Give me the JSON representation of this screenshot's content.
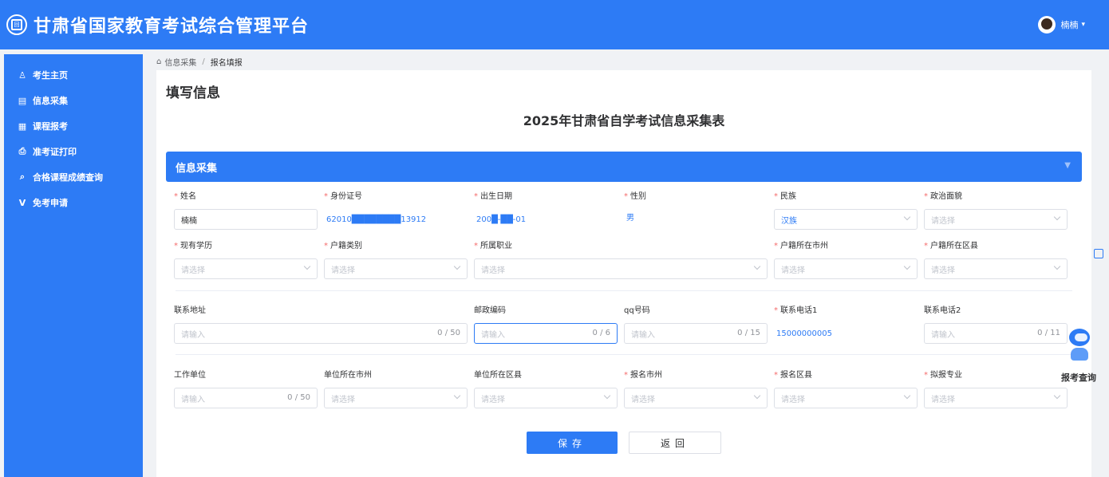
{
  "header": {
    "logo_glyph": "回",
    "title": "甘肃省国家教育考试综合管理平台",
    "username": "楠楠",
    "caret": "▾"
  },
  "sidebar": {
    "items": [
      {
        "icon": "user-icon",
        "glyph": "♙",
        "label": "考生主页"
      },
      {
        "icon": "document-icon",
        "glyph": "▤",
        "label": "信息采集"
      },
      {
        "icon": "calendar-icon",
        "glyph": "▦",
        "label": "课程报考"
      },
      {
        "icon": "print-icon",
        "glyph": "⎙",
        "label": "准考证打印"
      },
      {
        "icon": "search-icon",
        "glyph": "⌕",
        "label": "合格课程成绩查询"
      },
      {
        "icon": "exempt-icon",
        "glyph": "V",
        "label": "免考申请"
      }
    ]
  },
  "breadcrumb": {
    "home_glyph": "⌂",
    "parent": "信息采集",
    "sep": "/",
    "current": "报名填报"
  },
  "page": {
    "title": "填写信息",
    "form_title": "2025年甘肃省自学考试信息采集表",
    "section": "信息采集"
  },
  "fields": {
    "name": {
      "label": "姓名",
      "value": "楠楠"
    },
    "idcard": {
      "label": "身份证号",
      "value": "62010████████13912"
    },
    "birth": {
      "label": "出生日期",
      "value": "200█-██-01"
    },
    "gender": {
      "label": "性别",
      "value": "男"
    },
    "ethnic": {
      "label": "民族",
      "value": "汉族"
    },
    "political": {
      "label": "政治面貌",
      "placeholder": "请选择"
    },
    "education": {
      "label": "现有学历",
      "placeholder": "请选择"
    },
    "hukou_type": {
      "label": "户籍类别",
      "placeholder": "请选择"
    },
    "occupation": {
      "label": "所属职业",
      "placeholder": "请选择"
    },
    "hukou_city": {
      "label": "户籍所在市州",
      "placeholder": "请选择"
    },
    "hukou_county": {
      "label": "户籍所在区县",
      "placeholder": "请选择"
    },
    "address": {
      "label": "联系地址",
      "placeholder": "请输入",
      "count": "0 / 50"
    },
    "postcode": {
      "label": "邮政编码",
      "placeholder": "请输入",
      "count": "0 / 6"
    },
    "qq": {
      "label": "qq号码",
      "placeholder": "请输入",
      "count": "0 / 15"
    },
    "phone1": {
      "label": "联系电话1",
      "value": "15000000005"
    },
    "phone2": {
      "label": "联系电话2",
      "placeholder": "请输入",
      "count": "0 / 11"
    },
    "employer": {
      "label": "工作单位",
      "placeholder": "请输入",
      "count": "0 / 50"
    },
    "employer_city": {
      "label": "单位所在市州",
      "placeholder": "请选择"
    },
    "employer_county": {
      "label": "单位所在区县",
      "placeholder": "请选择"
    },
    "reg_city": {
      "label": "报名市州",
      "placeholder": "请选择"
    },
    "reg_county": {
      "label": "报名区县",
      "placeholder": "请选择"
    },
    "major": {
      "label": "拟报专业",
      "placeholder": "请选择"
    }
  },
  "buttons": {
    "save": "保存",
    "back": "返回"
  },
  "widget": {
    "label": "报考查询"
  },
  "colors": {
    "primary": "#2d7bf5",
    "required": "#f56c6c"
  }
}
